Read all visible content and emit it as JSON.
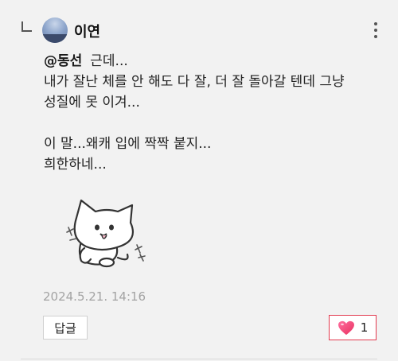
{
  "comment": {
    "author": "이연",
    "mention": "@동선",
    "first_line_text": "근데...",
    "lines": [
      "내가 잘난 체를 안 해도 다 잘, 더 잘 돌아갈 텐데 그냥",
      "성질에 못 이겨...",
      "",
      "이 말...왜캐 입에 짝짝 붙지...",
      "희한하네..."
    ],
    "timestamp": "2024.5.21. 14:16",
    "reply_label": "답글",
    "like_count": "1"
  },
  "icons": {
    "reply_indicator": "reply-arrow-icon",
    "more": "more-vertical-icon",
    "like": "heart-icon",
    "sticker": "cat-sticker"
  },
  "colors": {
    "background": "#f2f2f2",
    "like_border": "#e23a4f",
    "heart": "#f0457a",
    "timestamp": "#a3a3a3"
  }
}
